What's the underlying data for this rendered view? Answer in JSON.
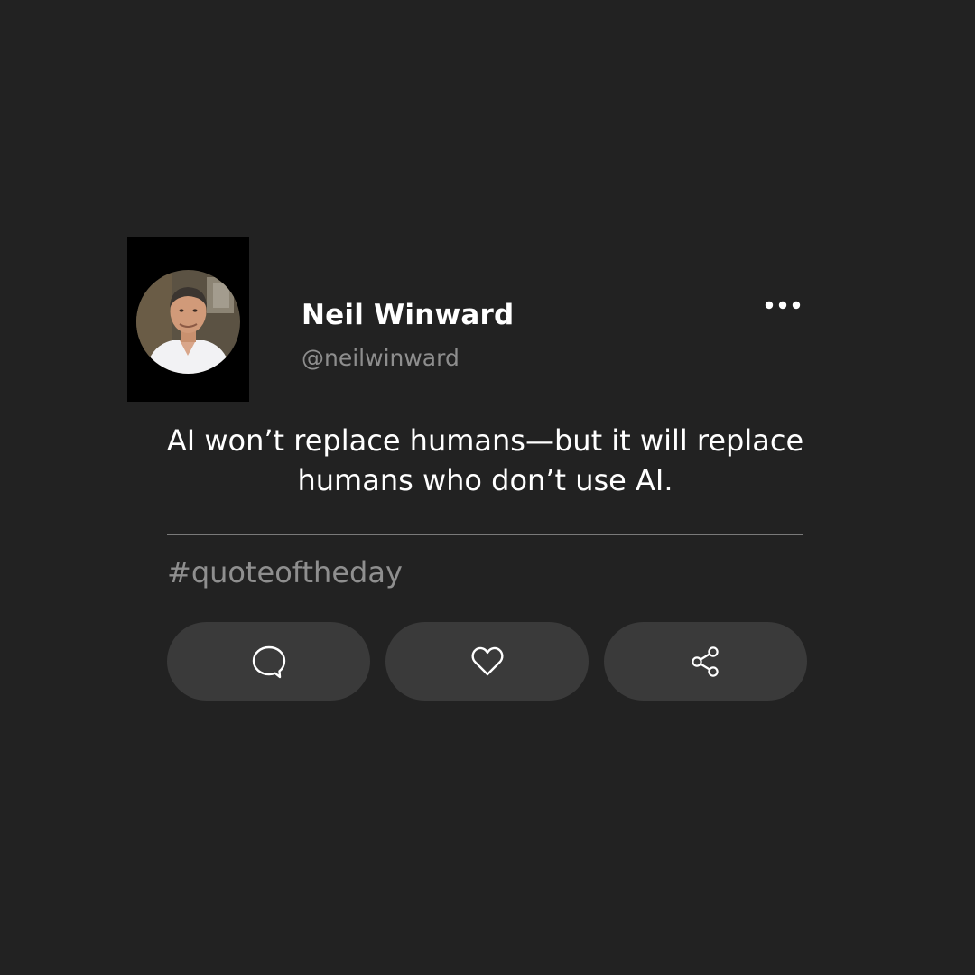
{
  "post": {
    "author": {
      "display_name": "Neil Winward",
      "handle": "@neilwinward"
    },
    "menu_icon": "more-horizontal-icon",
    "quote": "AI won’t replace humans—but it will replace humans who don’t use AI.",
    "hashtag": "#quoteoftheday"
  },
  "actions": [
    {
      "name": "comment",
      "icon": "speech-bubble-icon"
    },
    {
      "name": "like",
      "icon": "heart-icon"
    },
    {
      "name": "share",
      "icon": "share-icon"
    }
  ],
  "colors": {
    "background": "#222222",
    "button_background": "#3a3a3a",
    "primary_text": "#ffffff",
    "secondary_text": "#8e8e8e",
    "divider": "#7a7a7a"
  }
}
